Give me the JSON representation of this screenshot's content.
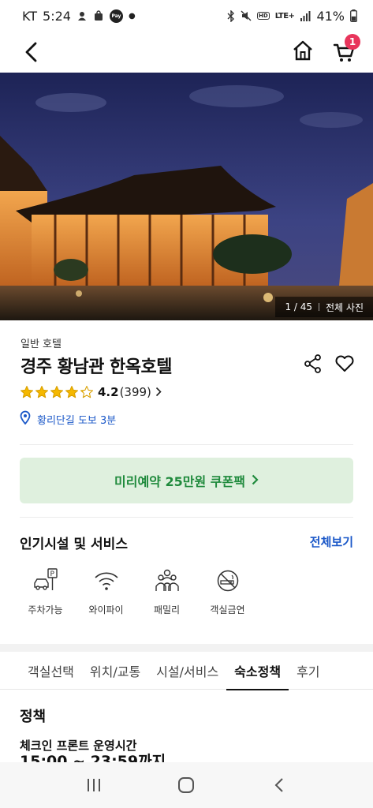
{
  "status_bar": {
    "carrier": "KT",
    "time": "5:24",
    "pay_label": "Pay",
    "hd_label": "HD",
    "lte_label": "LTE+",
    "battery": "41%"
  },
  "header": {
    "cart_count": "1"
  },
  "hero": {
    "counter": "1 / 45",
    "all_photos": "전체 사진"
  },
  "hotel": {
    "category": "일반 호텔",
    "name": "경주 황남관 한옥호텔",
    "rating": "4.2",
    "review_count": "(399)",
    "stars": 4.2,
    "location": "황리단길 도보 3분"
  },
  "coupon": {
    "label": "미리예약 25만원 쿠폰팩"
  },
  "amenities_section": {
    "title": "인기시설 및 서비스",
    "view_all": "전체보기",
    "items": [
      {
        "icon": "parking-icon",
        "label": "주차가능"
      },
      {
        "icon": "wifi-icon",
        "label": "와이파이"
      },
      {
        "icon": "family-icon",
        "label": "패밀리"
      },
      {
        "icon": "no-smoking-icon",
        "label": "객실금연"
      }
    ]
  },
  "tabs": [
    {
      "label": "객실선택"
    },
    {
      "label": "위치/교통"
    },
    {
      "label": "시설/서비스"
    },
    {
      "label": "숙소정책",
      "active": true
    },
    {
      "label": "후기"
    }
  ],
  "policy": {
    "title": "정책",
    "checkin_label": "체크인 프론트 운영시간",
    "checkin_time": "15:00 ~ 23:59까지"
  },
  "colors": {
    "accent_blue": "#1b58c8",
    "coupon_green": "#1f8a3c",
    "coupon_bg": "#dff0de",
    "badge_red": "#e8355b",
    "star_yellow": "#f5b800"
  }
}
